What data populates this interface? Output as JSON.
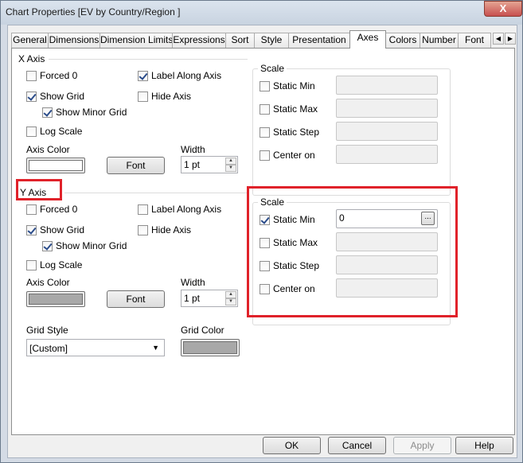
{
  "window": {
    "title": "Chart Properties [EV by Country/Region ]",
    "close_glyph": "X"
  },
  "tabs": [
    {
      "label": "General"
    },
    {
      "label": "Dimensions"
    },
    {
      "label": "Dimension Limits"
    },
    {
      "label": "Expressions"
    },
    {
      "label": "Sort"
    },
    {
      "label": "Style"
    },
    {
      "label": "Presentation"
    },
    {
      "label": "Axes"
    },
    {
      "label": "Colors"
    },
    {
      "label": "Number"
    },
    {
      "label": "Font"
    }
  ],
  "active_tab": "Axes",
  "tab_scroll": {
    "left": "◀",
    "right": "▶"
  },
  "x_axis": {
    "title": "X Axis",
    "forced0": "Forced 0",
    "label_along_axis": "Label Along Axis",
    "show_grid": "Show Grid",
    "hide_axis": "Hide Axis",
    "show_minor_grid": "Show Minor Grid",
    "log_scale": "Log Scale",
    "axis_color_label": "Axis Color",
    "axis_color": "#ffffff",
    "font_button": "Font",
    "width_label": "Width",
    "width_value": "1 pt",
    "scale": {
      "title": "Scale",
      "static_min": "Static Min",
      "static_max": "Static Max",
      "static_step": "Static Step",
      "center_on": "Center on"
    }
  },
  "y_axis": {
    "title": "Y Axis",
    "forced0": "Forced 0",
    "label_along_axis": "Label Along Axis",
    "show_grid": "Show Grid",
    "hide_axis": "Hide Axis",
    "show_minor_grid": "Show Minor Grid",
    "log_scale": "Log Scale",
    "axis_color_label": "Axis Color",
    "axis_color": "#a8a8a8",
    "font_button": "Font",
    "width_label": "Width",
    "width_value": "1 pt",
    "scale": {
      "title": "Scale",
      "static_min": "Static Min",
      "static_min_value": "0",
      "ellipsis": "...",
      "static_max": "Static Max",
      "static_step": "Static Step",
      "center_on": "Center on"
    }
  },
  "grid": {
    "style_label": "Grid Style",
    "style_value": "[Custom]",
    "color_label": "Grid Color",
    "color": "#a8a8a8"
  },
  "footer": {
    "ok": "OK",
    "cancel": "Cancel",
    "apply": "Apply",
    "help": "Help"
  },
  "colors": {
    "highlight": "#e0222a"
  }
}
